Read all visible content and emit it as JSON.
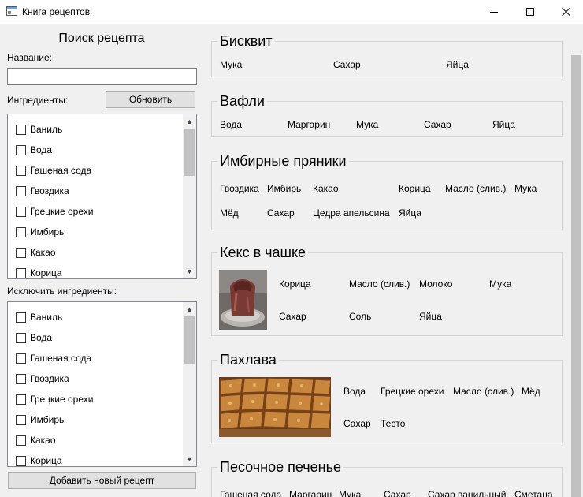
{
  "window": {
    "title": "Книга рецептов"
  },
  "search": {
    "title": "Поиск рецепта",
    "name_label": "Название:",
    "name_value": "",
    "ingredients_label": "Ингредиенты:",
    "refresh_button": "Обновить",
    "exclude_label": "Исключить ингредиенты:",
    "add_button": "Добавить новый рецепт",
    "include_items": [
      "Ваниль",
      "Вода",
      "Гашеная сода",
      "Гвоздика",
      "Грецкие орехи",
      "Имбирь",
      "Какао",
      "Корица"
    ],
    "exclude_items": [
      "Ваниль",
      "Вода",
      "Гашеная сода",
      "Гвоздика",
      "Грецкие орехи",
      "Имбирь",
      "Какао",
      "Корица"
    ]
  },
  "recipes": [
    {
      "title": "Бисквит",
      "ingredients": [
        "Мука",
        "Сахар",
        "Яйца"
      ]
    },
    {
      "title": "Вафли",
      "ingredients": [
        "Вода",
        "Маргарин",
        "Мука",
        "Сахар",
        "Яйца"
      ]
    },
    {
      "title": "Имбирные пряники",
      "ingredients": [
        "Гвоздика",
        "Имбирь",
        "Какао",
        "Корица",
        "Масло (слив.)",
        "Мука",
        "Мёд",
        "Сахар",
        "Цедра апельсина",
        "Яйца"
      ]
    },
    {
      "title": "Кекс в чашке",
      "ingredients": [
        "Корица",
        "Масло (слив.)",
        "Молоко",
        "Мука",
        "Сахар",
        "Соль",
        "Яйца"
      ]
    },
    {
      "title": "Пахлава",
      "ingredients": [
        "Вода",
        "Грецкие орехи",
        "Масло (слив.)",
        "Мёд",
        "Сахар",
        "Тесто"
      ]
    },
    {
      "title": "Песочное печенье",
      "ingredients": [
        "Гашеная сода",
        "Маргарин",
        "Мука",
        "Сахар",
        "Сахар ванильный",
        "Сметана"
      ]
    }
  ]
}
